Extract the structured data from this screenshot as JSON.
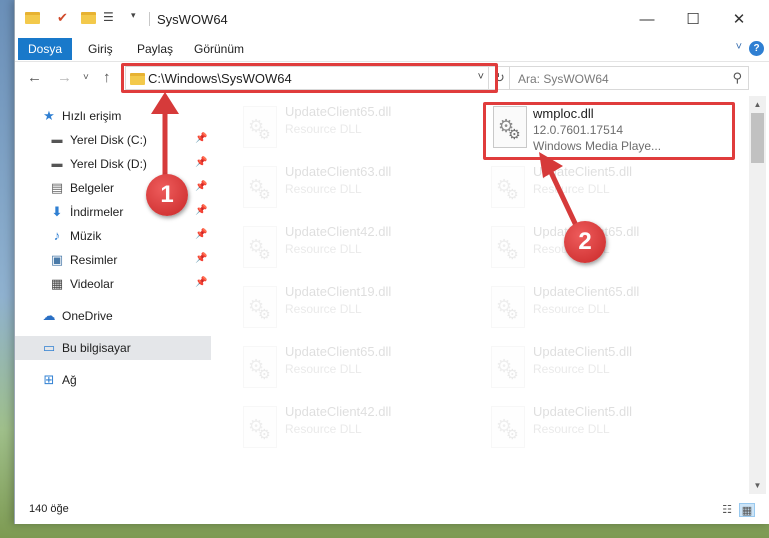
{
  "window": {
    "title": "SysWOW64"
  },
  "ribbon": {
    "tabs": [
      "Dosya",
      "Giriş",
      "Paylaş",
      "Görünüm"
    ],
    "help": "?"
  },
  "nav": {
    "back": "←",
    "forward": "→",
    "recent": "˅",
    "up": "↑",
    "address": "C:\\Windows\\SysWOW64",
    "address_dropdown": "˅",
    "refresh": "↻",
    "search_placeholder": "Ara: SysWOW64"
  },
  "sidebar": {
    "items": [
      {
        "label": "Hızlı erişim",
        "icon": "star-icon"
      },
      {
        "label": "Yerel Disk (C:)",
        "icon": "drive-icon"
      },
      {
        "label": "Yerel Disk (D:)",
        "icon": "drive-icon"
      },
      {
        "label": "Belgeler",
        "icon": "document-icon"
      },
      {
        "label": "İndirmeler",
        "icon": "download-icon"
      },
      {
        "label": "Müzik",
        "icon": "music-icon"
      },
      {
        "label": "Resimler",
        "icon": "pictures-icon"
      },
      {
        "label": "Videolar",
        "icon": "video-icon"
      },
      {
        "label": "OneDrive",
        "icon": "cloud-icon"
      },
      {
        "label": "Bu bilgisayar",
        "icon": "computer-icon"
      },
      {
        "label": "Ağ",
        "icon": "network-icon"
      }
    ]
  },
  "files": {
    "highlighted": {
      "name": "wmploc.dll",
      "version": "12.0.7601.17514",
      "description": "Windows Media Playe..."
    },
    "left_column": [
      {
        "name": "UpdateClient65.dll",
        "type": "Resource DLL"
      },
      {
        "name": "UpdateClient63.dll",
        "type": "Resource DLL"
      },
      {
        "name": "UpdateClient42.dll",
        "type": "Resource DLL"
      },
      {
        "name": "UpdateClient19.dll",
        "type": "Resource DLL"
      },
      {
        "name": "UpdateClient65.dll",
        "type": "Resource DLL"
      },
      {
        "name": "UpdateClient42.dll",
        "type": "Resource DLL"
      }
    ],
    "right_column": [
      {
        "name": "UpdateClient5.dll",
        "type": "Resource DLL"
      },
      {
        "name": "UpdateClient65.dll",
        "type": "Resource DLL"
      },
      {
        "name": "UpdateClient65.dll",
        "type": "Resource DLL"
      },
      {
        "name": "UpdateClient5.dll",
        "type": "Resource DLL"
      },
      {
        "name": "UpdateClient5.dll",
        "type": "Resource DLL"
      }
    ]
  },
  "status": {
    "item_count": "140 öğe"
  },
  "callouts": [
    "1",
    "2"
  ],
  "colors": {
    "accent": "#1979ca",
    "highlight": "#e03c3c"
  }
}
